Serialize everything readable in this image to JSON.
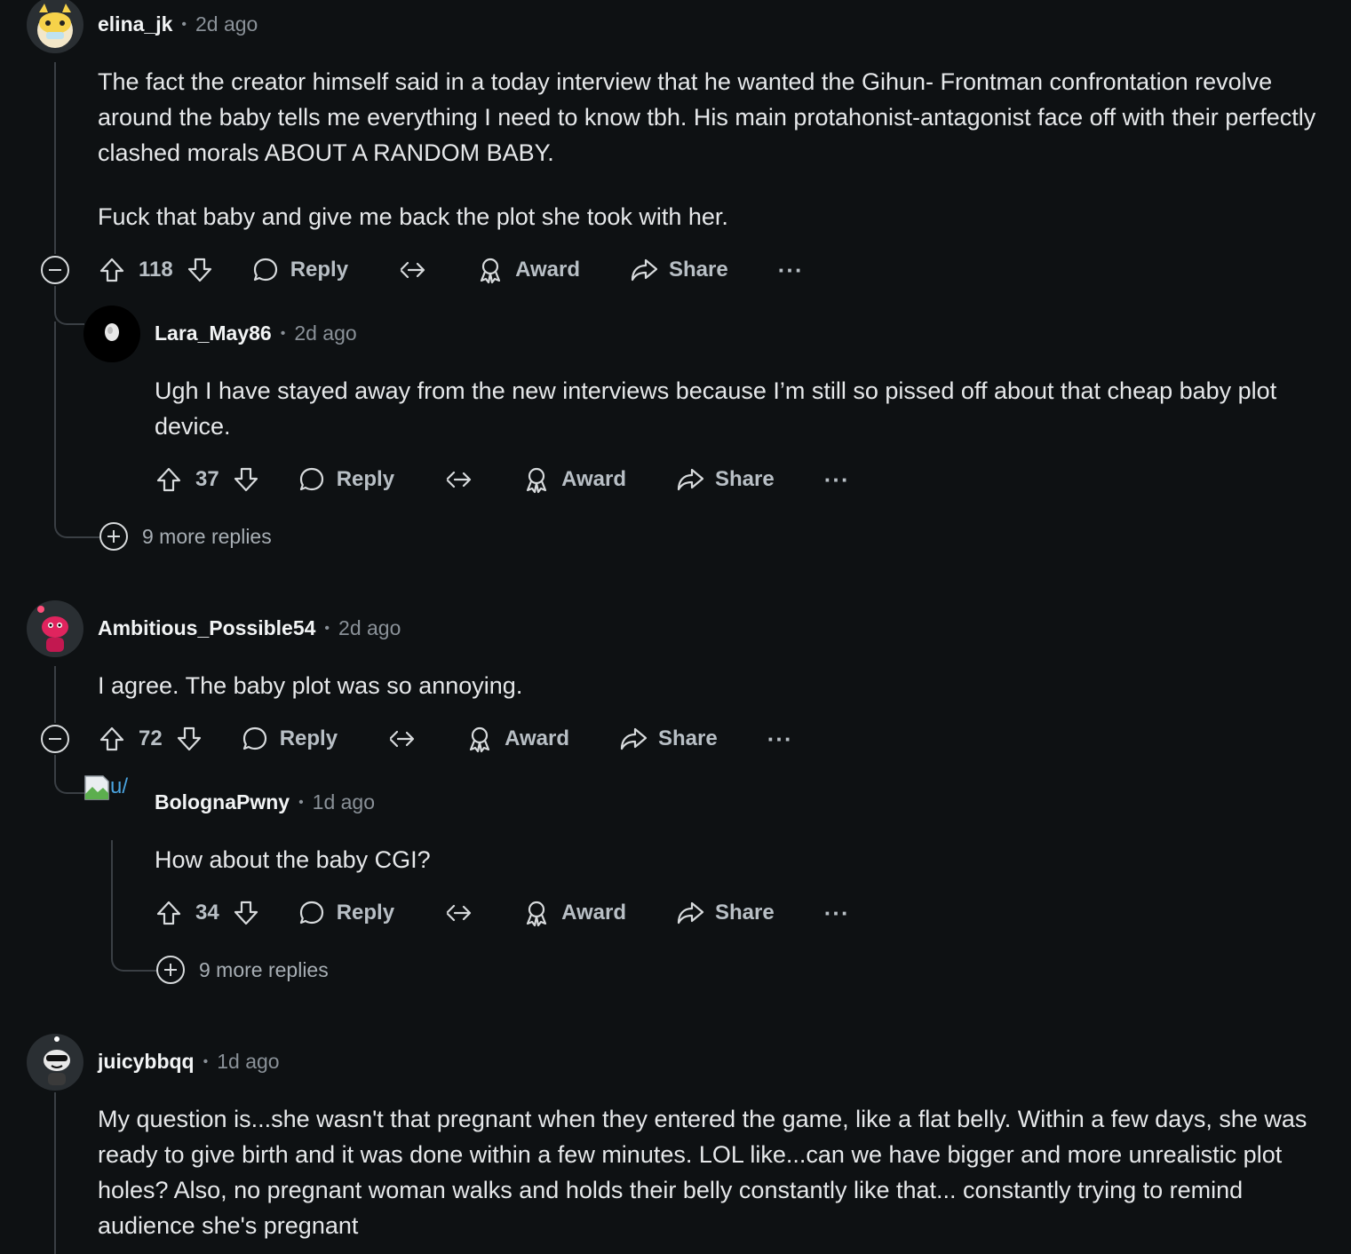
{
  "comments": [
    {
      "user": "elina_jk",
      "time": "2d ago",
      "paragraphs": [
        "The fact the creator himself said in a today interview that he wanted the Gihun- Frontman confrontation revolve around the baby tells me everything I need to know tbh. His main protahonist-antagonist face off with their perfectly clashed morals ABOUT A RANDOM BABY.",
        "Fuck that baby and give me back the plot she took with her."
      ],
      "score": "118",
      "reply_label": "Reply",
      "award_label": "Award",
      "share_label": "Share",
      "more_replies": "9 more replies",
      "reply": {
        "user": "Lara_May86",
        "time": "2d ago",
        "text": "Ugh I have stayed away from the new interviews because I’m still so pissed off about that cheap baby plot device.",
        "score": "37",
        "reply_label": "Reply",
        "award_label": "Award",
        "share_label": "Share"
      }
    },
    {
      "user": "Ambitious_Possible54",
      "time": "2d ago",
      "text": "I agree. The baby plot was so annoying.",
      "score": "72",
      "reply_label": "Reply",
      "award_label": "Award",
      "share_label": "Share",
      "reply": {
        "user": "BolognaPwny",
        "avatar_alt": "u/",
        "time": "1d ago",
        "text": "How about the baby CGI?",
        "score": "34",
        "reply_label": "Reply",
        "award_label": "Award",
        "share_label": "Share",
        "more_replies": "9 more replies"
      }
    },
    {
      "user": "juicybbqq",
      "time": "1d ago",
      "text": "My question is...she wasn't that pregnant when they entered the game, like a flat belly. Within a few days, she was ready to give birth and it was done within a few minutes. LOL like...can we have bigger and more unrealistic plot holes? Also, no pregnant woman walks and holds their belly constantly like that... constantly trying to remind audience she's pregnant"
    }
  ]
}
